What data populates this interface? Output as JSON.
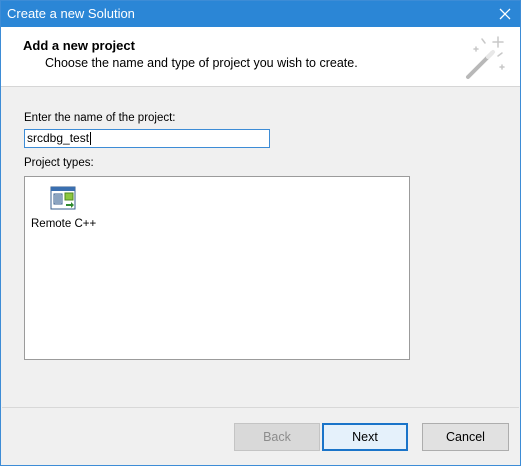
{
  "window": {
    "title": "Create a new Solution"
  },
  "header": {
    "title": "Add a new project",
    "subtitle": "Choose the name and type of project you wish to create."
  },
  "form": {
    "name_label": "Enter the name of the project:",
    "name_value": "srcdbg_test",
    "types_label": "Project types:",
    "project_types": [
      {
        "label": "Remote C++",
        "icon": "remote-cpp-project-icon"
      }
    ]
  },
  "buttons": {
    "back": "Back",
    "next": "Next",
    "cancel": "Cancel"
  },
  "colors": {
    "titlebar": "#2b86d6",
    "accent_border": "#1a74c9",
    "background": "#f0f0f0"
  }
}
